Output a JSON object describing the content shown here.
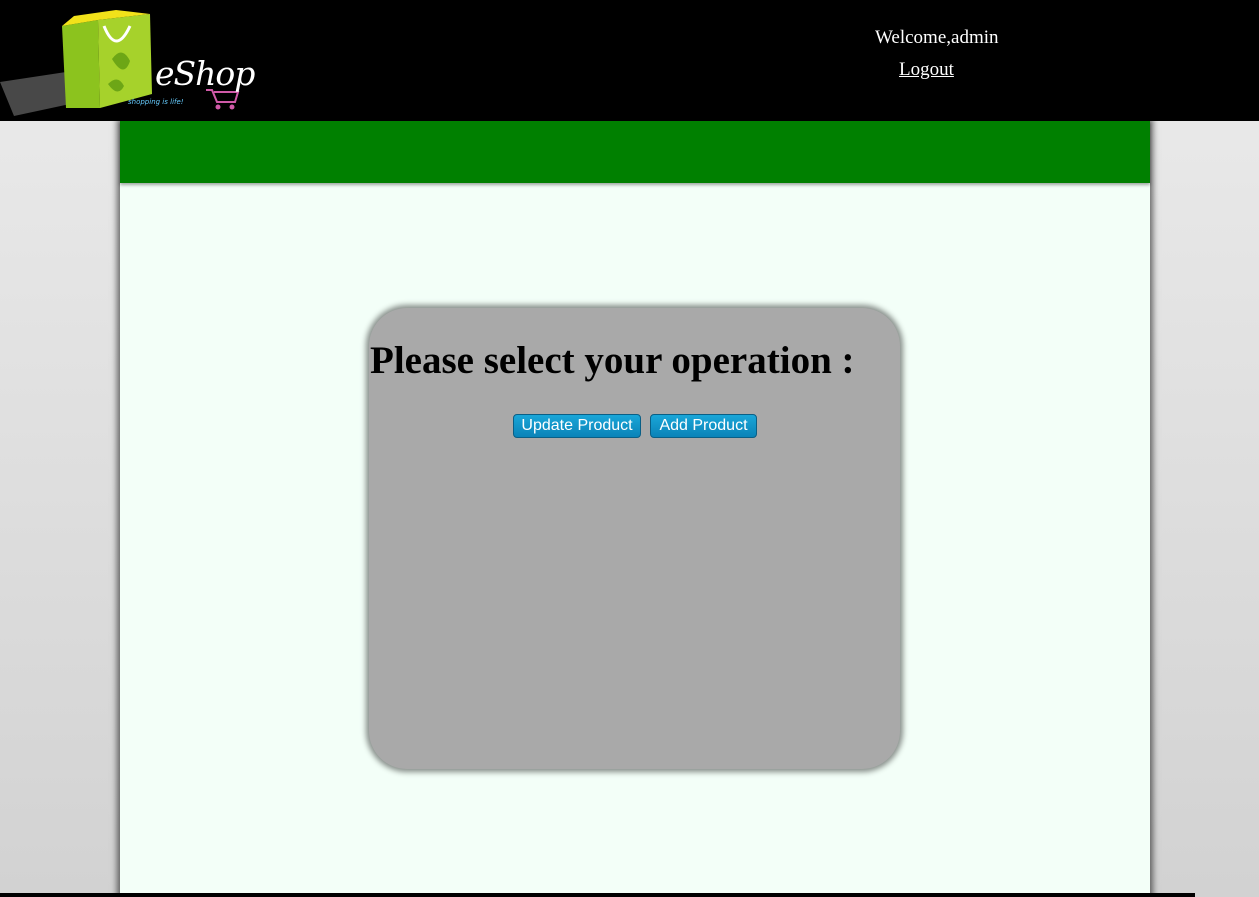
{
  "header": {
    "logo": {
      "icon": "shopping-bag-icon",
      "brand": "eShop",
      "tagline": "shopping is life!",
      "cart_icon": "cart-icon"
    },
    "welcome_text": "Welcome,admin",
    "logout_label": "Logout"
  },
  "main": {
    "panel": {
      "title": "Please select your operation :",
      "buttons": {
        "update_label": "Update Product",
        "add_label": "Add Product"
      }
    }
  },
  "colors": {
    "header_bg": "#000000",
    "banner_green": "#008000",
    "content_bg": "#f3fff8",
    "panel_bg": "#a9a9a9",
    "button_blue": "#0a83b8"
  }
}
